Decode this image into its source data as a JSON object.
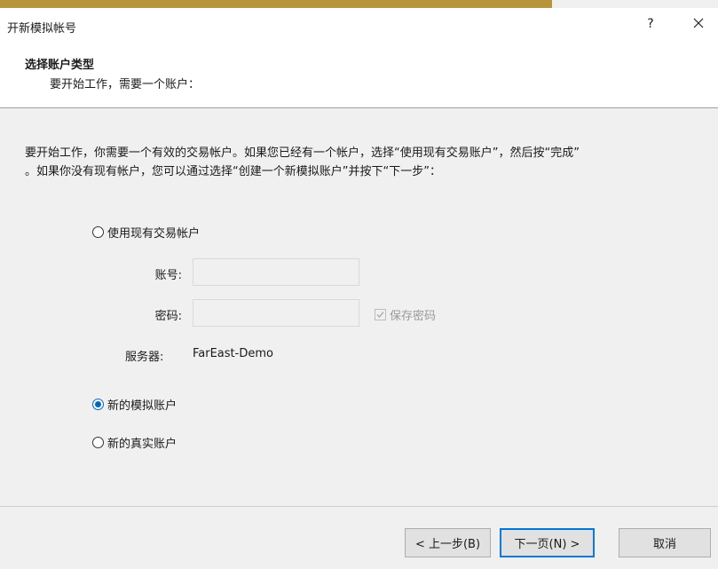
{
  "window": {
    "title": "开新模拟帐号",
    "help_glyph": "?",
    "accent_color": "#b8953a"
  },
  "header": {
    "title": "选择账户类型",
    "subtitle": "要开始工作，需要一个账户："
  },
  "intro": {
    "line1": "要开始工作，你需要一个有效的交易帐户。如果您已经有一个帐户，选择“使用现有交易账户”，然后按“完成”",
    "line2": "。如果你没有现有帐户，您可以通过选择“创建一个新模拟账户”并按下“下一步”："
  },
  "options": {
    "existing": {
      "label": "使用现有交易帐户",
      "checked": false
    },
    "demo": {
      "label": "新的模拟账户",
      "checked": true
    },
    "real": {
      "label": "新的真实账户",
      "checked": false
    }
  },
  "fields": {
    "account_label": "账号:",
    "account_value": "",
    "password_label": "密码:",
    "password_value": "",
    "save_password_label": "保存密码",
    "save_password_checked": true,
    "server_label": "服务器:",
    "server_value": "FarEast-Demo"
  },
  "buttons": {
    "back": "< 上一步(B)",
    "next": "下一页(N) >",
    "cancel": "取消"
  },
  "icons": {
    "close": "close-icon",
    "help": "help-icon",
    "checkmark": "checkmark-icon"
  },
  "colors": {
    "radio_selected": "#0067c0",
    "primary_button_border": "#0078d7"
  }
}
